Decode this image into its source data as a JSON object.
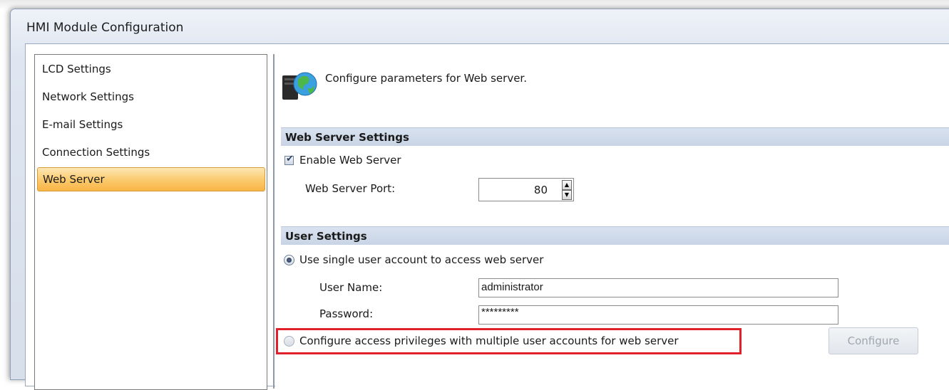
{
  "window": {
    "title": "HMI Module Configuration"
  },
  "sidebar": {
    "items": [
      {
        "label": "LCD Settings",
        "selected": false
      },
      {
        "label": "Network Settings",
        "selected": false
      },
      {
        "label": "E-mail Settings",
        "selected": false
      },
      {
        "label": "Connection Settings",
        "selected": false
      },
      {
        "label": "Web Server",
        "selected": true
      }
    ]
  },
  "header": {
    "icon": "web-server-globe-icon",
    "text": "Configure parameters for Web server."
  },
  "web_server_settings": {
    "title": "Web Server Settings",
    "enable_label": "Enable Web Server",
    "enable_checked": true,
    "port_label": "Web Server Port:",
    "port_value": "80"
  },
  "user_settings": {
    "title": "User Settings",
    "single_user_label": "Use single user account to access web server",
    "single_user_selected": true,
    "username_label": "User Name:",
    "username_value": "administrator",
    "password_label": "Password:",
    "password_value": "*********",
    "multi_user_label": "Configure access privileges with multiple user accounts for web server",
    "multi_user_selected": false,
    "configure_label": "Configure"
  },
  "colors": {
    "highlight": "#e0202a",
    "selected_item": "#fbc96b",
    "section_header": "#c8d4e5"
  }
}
